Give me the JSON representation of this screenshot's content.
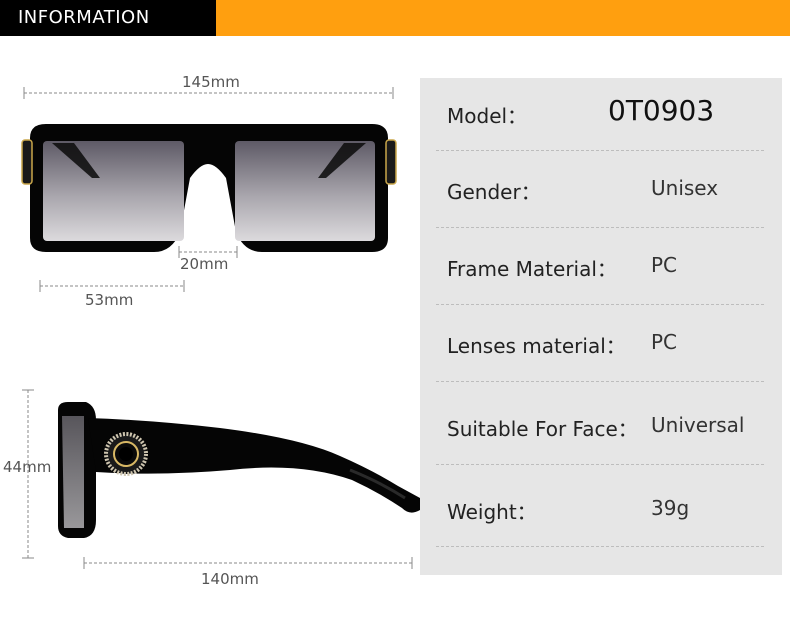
{
  "header": {
    "title": "INFORMATION"
  },
  "colors": {
    "accent": "#ff9f0f",
    "header_bg": "#000000",
    "panel_bg": "#e6e6e6"
  },
  "dimensions": {
    "total_width": "145mm",
    "bridge": "20mm",
    "lens_width": "53mm",
    "lens_height": "44mm",
    "temple_length": "140mm"
  },
  "specs": [
    {
      "label": "Model：",
      "value": "0T0903"
    },
    {
      "label": "Gender：",
      "value": "Unisex"
    },
    {
      "label": "Frame Material：",
      "value": "PC"
    },
    {
      "label": "Lenses material：",
      "value": "PC"
    },
    {
      "label": "Suitable For Face：",
      "value": "Universal"
    },
    {
      "label": "Weight：",
      "value": "39g"
    }
  ]
}
